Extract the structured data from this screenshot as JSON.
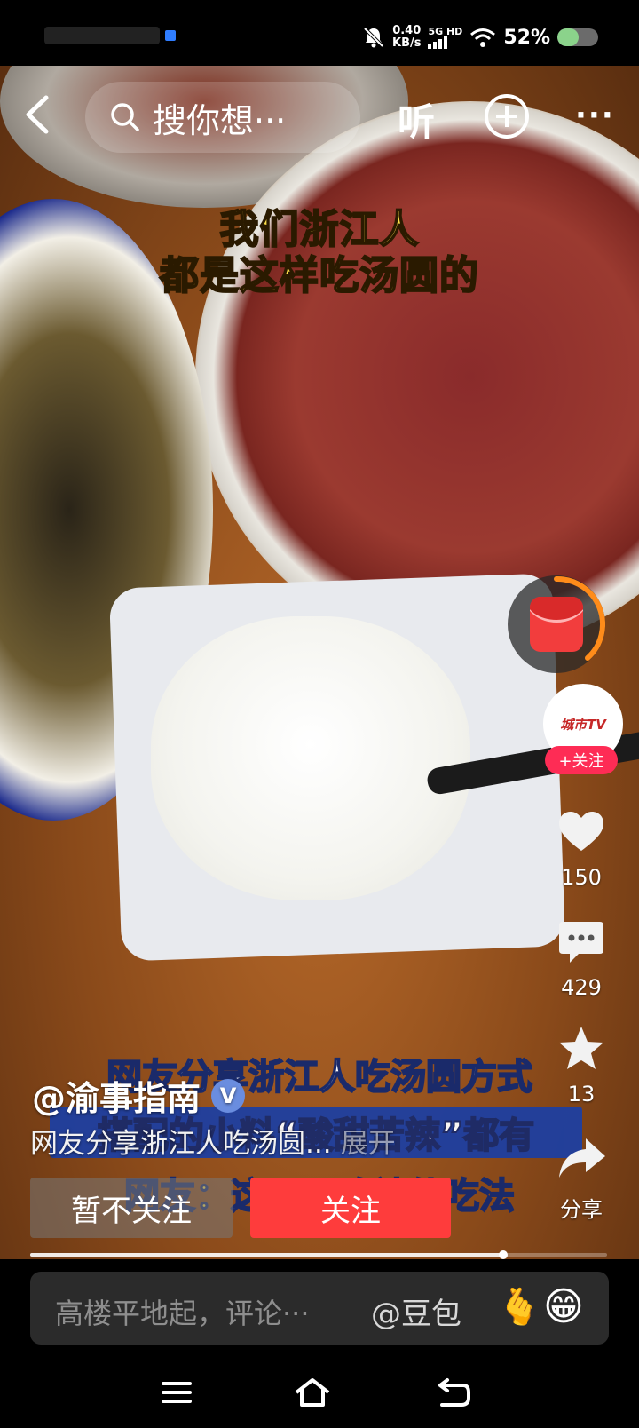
{
  "status_bar": {
    "net_speed_value": "0.40",
    "net_speed_unit": "KB/s",
    "signal_label": "5G HD",
    "battery_percent": "52%",
    "battery_level": 0.52
  },
  "top_bar": {
    "search_placeholder": "搜你想···",
    "listen_label": "听",
    "more_label": "···"
  },
  "video": {
    "caption_line1": "我们浙江人",
    "caption_line2": "都是这样吃汤圆的",
    "subtitle_line1": "网友分享浙江人吃汤圆方式",
    "subtitle_line2": "搭配的小料“酸甜苦辣”都有",
    "subtitle_line3": "网友：这是哪路神仙吃法"
  },
  "sidebar": {
    "avatar_logo": "城市TV",
    "follow_chip": "+关注",
    "likes": "150",
    "comments": "429",
    "favorites": "13",
    "share_label": "分享"
  },
  "post": {
    "author": "@渝事指南",
    "verified_mark": "V",
    "description": "网友分享浙江人吃汤圆...",
    "expand_label": "展开"
  },
  "actions": {
    "no_follow_label": "暂不关注",
    "follow_label": "关注"
  },
  "playback": {
    "progress": 0.82
  },
  "comment_bar": {
    "placeholder": "高楼平地起，评论···",
    "mention": "@豆包",
    "emoji_heart_hand": "🫰",
    "emoji_grin": "😁"
  },
  "colors": {
    "accent_red": "#fe3c3c",
    "follow_pink": "#fe2c55",
    "caption_yellow": "#ffe14a"
  }
}
